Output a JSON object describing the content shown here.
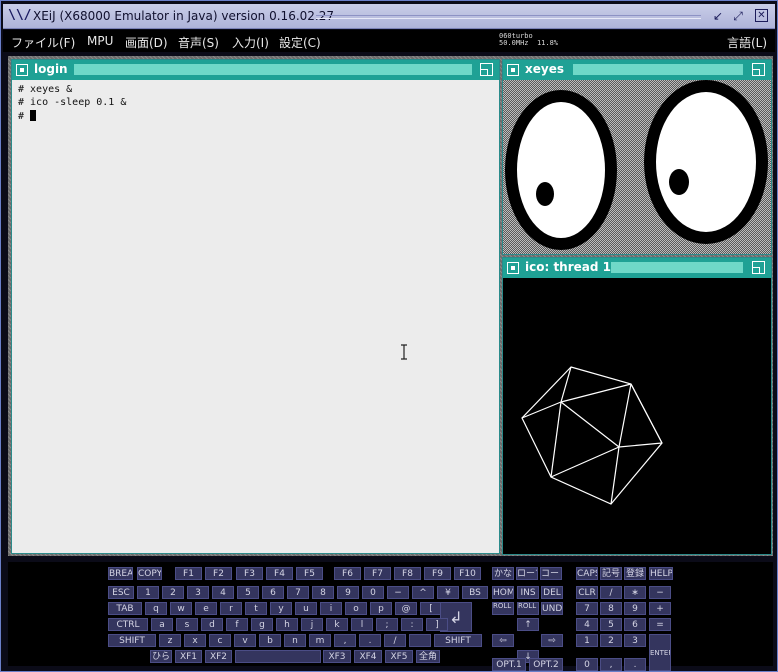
{
  "title": "XEiJ (X68000 Emulator in Java) version 0.16.02.27",
  "menu": {
    "items": [
      "ファイル(F)",
      "MPU",
      "画面(D)",
      "音声(S)",
      "入力(I)",
      "設定(C)"
    ],
    "language": "言語(L)"
  },
  "status": {
    "cpu": "060turbo",
    "clock": "50.0MHz",
    "percent": "11.8%"
  },
  "windows": {
    "login": {
      "title": "login",
      "lines": [
        "# xeyes &",
        "# ico -sleep 0.1 &",
        "# "
      ]
    },
    "xeyes": {
      "title": "xeyes"
    },
    "ico": {
      "title": "ico: thread 1"
    }
  },
  "keyboard": {
    "row0": [
      "BREAK",
      "COPY",
      "F1",
      "F2",
      "F3",
      "F4",
      "F5",
      "F6",
      "F7",
      "F8",
      "F9",
      "F10",
      "かな",
      "ローマ",
      "コード",
      "CAPS",
      "記号",
      "登録",
      "HELP"
    ],
    "row1": [
      "ESC",
      "1",
      "2",
      "3",
      "4",
      "5",
      "6",
      "7",
      "8",
      "9",
      "0",
      "−",
      "^",
      "¥",
      "BS",
      "HOME",
      "INS",
      "DEL",
      "CLR",
      "∕",
      "∗",
      "−"
    ],
    "row2": [
      "TAB",
      "q",
      "w",
      "e",
      "r",
      "t",
      "y",
      "u",
      "i",
      "o",
      "p",
      "@",
      "[",
      "ROLL UP",
      "ROLL DOWN",
      "UNDO",
      "7",
      "8",
      "9",
      "+"
    ],
    "row3": [
      "CTRL",
      "a",
      "s",
      "d",
      "f",
      "g",
      "h",
      "j",
      "k",
      "l",
      ";",
      ":",
      "]",
      "↑",
      "4",
      "5",
      "6",
      "="
    ],
    "row4": [
      "SHIFT",
      "z",
      "x",
      "c",
      "v",
      "b",
      "n",
      "m",
      ",",
      ".",
      "∕",
      "",
      "SHIFT",
      "⇦",
      "⇨",
      "1",
      "2",
      "3"
    ],
    "row5": [
      "ひら",
      "XF1",
      "XF2",
      "",
      "XF3",
      "XF4",
      "XF5",
      "全角",
      "↓",
      "OPT.1",
      "OPT.2",
      "0",
      ",",
      ".",
      "ENTER"
    ],
    "return": "↲"
  }
}
